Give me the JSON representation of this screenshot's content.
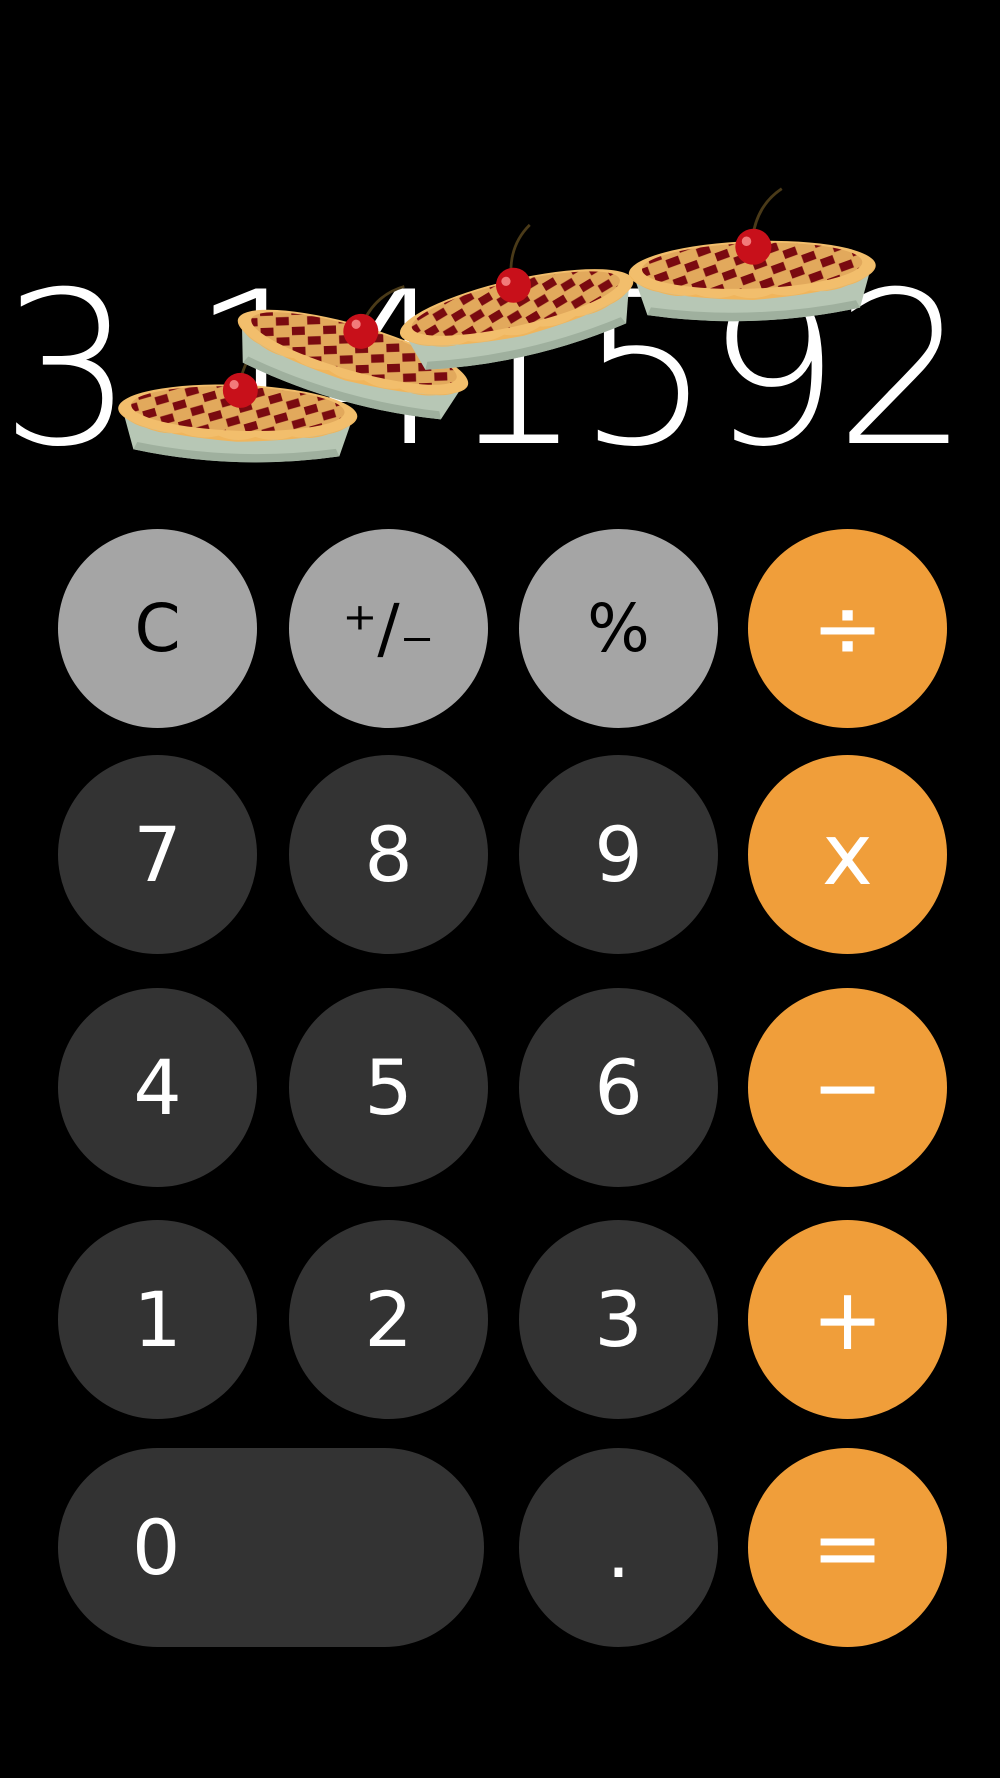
{
  "display": {
    "value": "3.141592"
  },
  "decoration": {
    "icon": "cherry-pie-icon",
    "count": 4
  },
  "keys": {
    "clear": "C",
    "plus_minus": "⁺∕₋",
    "percent": "%",
    "divide": "÷",
    "seven": "7",
    "eight": "8",
    "nine": "9",
    "multiply": "x",
    "four": "4",
    "five": "5",
    "six": "6",
    "subtract": "−",
    "one": "1",
    "two": "2",
    "three": "3",
    "add": "+",
    "zero": "0",
    "decimal": ".",
    "equals": "="
  },
  "colors": {
    "background": "#000000",
    "function_key": "#a5a5a5",
    "number_key": "#333333",
    "operator_key": "#f09e3a",
    "crust": "#e8b060",
    "filling": "#7a0a10",
    "tin": "#b7c7b5",
    "cherry": "#c8101a"
  }
}
